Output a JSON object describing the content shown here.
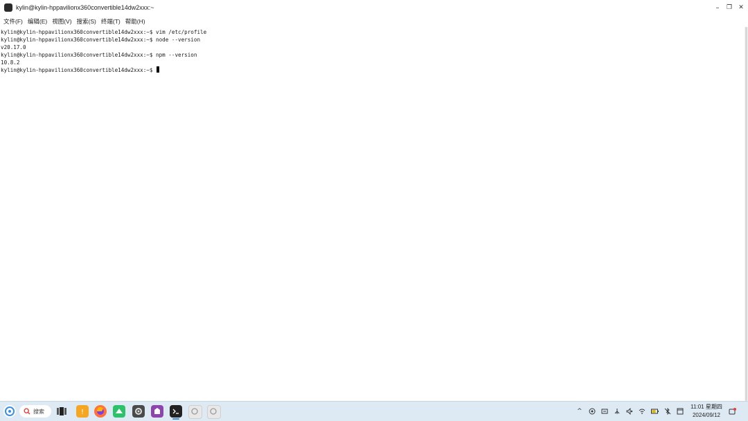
{
  "window": {
    "title": "kylin@kylin-hppavilionx360convertible14dw2xxx:~",
    "controls": {
      "minimize": "–",
      "restore": "❐",
      "close": "✕"
    }
  },
  "menubar": {
    "items": [
      {
        "label": "文件(F)"
      },
      {
        "label": "编辑(E)"
      },
      {
        "label": "视图(V)"
      },
      {
        "label": "搜索(S)"
      },
      {
        "label": "终端(T)"
      },
      {
        "label": "帮助(H)"
      }
    ]
  },
  "terminal": {
    "lines": [
      "kylin@kylin-hppavilionx360convertible14dw2xxx:~$ vim /etc/profile",
      "kylin@kylin-hppavilionx360convertible14dw2xxx:~$ node --version",
      "v20.17.0",
      "kylin@kylin-hppavilionx360convertible14dw2xxx:~$ npm --version",
      "10.8.2",
      "kylin@kylin-hppavilionx360convertible14dw2xxx:~$ "
    ]
  },
  "taskbar": {
    "search_placeholder": "搜索",
    "apps": [
      {
        "name": "start-menu-icon",
        "color": "#3a8ee6"
      },
      {
        "name": "multitask-view-icon",
        "color": "#333333"
      },
      {
        "name": "software-store-icon",
        "color": "#f5a623"
      },
      {
        "name": "firefox-icon",
        "color": "#ff7139"
      },
      {
        "name": "wechat-icon",
        "color": "#2ec16b"
      },
      {
        "name": "settings-icon",
        "color": "#555555"
      },
      {
        "name": "kylin-app-icon",
        "color": "#8e44ad"
      },
      {
        "name": "terminal-icon",
        "color": "#222222"
      },
      {
        "name": "disk-icon-1",
        "color": "#bfbfbf"
      },
      {
        "name": "disk-icon-2",
        "color": "#bfbfbf"
      }
    ],
    "tray": {
      "chevron": "^",
      "time": "11:01 星期四",
      "date": "2024/09/12"
    }
  }
}
